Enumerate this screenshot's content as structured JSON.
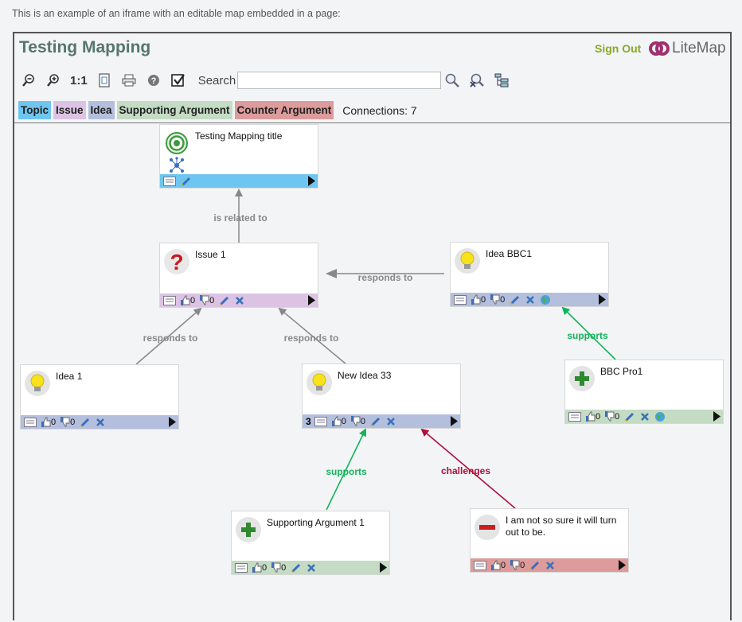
{
  "intro": "This is an example of an iframe with an editable map embedded in a page:",
  "header": {
    "title": "Testing Mapping",
    "sign_out": "Sign Out",
    "logo_text": "LiteMap"
  },
  "toolbar": {
    "actual_size": "1:1",
    "search_label": "Search",
    "search_value": ""
  },
  "legend": {
    "topic": "Topic",
    "issue": "Issue",
    "idea": "Idea",
    "supporting": "Supporting Argument",
    "counter": "Counter Argument",
    "connections": "Connections: 7"
  },
  "colors": {
    "topic": "#6ec6f0",
    "issue": "#dcc3e3",
    "idea": "#b4bfdd",
    "supporting": "#c4dbc4",
    "counter": "#dd9b9b",
    "neutral_link": "#888888",
    "support_link": "#11b45a",
    "challenge_link": "#b0103a"
  },
  "nodes": {
    "topic": {
      "title": "Testing Mapping title"
    },
    "issue1": {
      "title": "Issue 1",
      "votes_up": "0",
      "votes_down": "0"
    },
    "ideabbc1": {
      "title": "Idea BBC1",
      "votes_up": "0",
      "votes_down": "0"
    },
    "idea1": {
      "title": "Idea 1",
      "votes_up": "0",
      "votes_down": "0"
    },
    "newidea33": {
      "title": "New Idea 33",
      "count": "3",
      "votes_up": "0",
      "votes_down": "0"
    },
    "bbcpro1": {
      "title": "BBC Pro1",
      "votes_up": "0",
      "votes_down": "0"
    },
    "supporting1": {
      "title": "Supporting Argument 1",
      "votes_up": "0",
      "votes_down": "0"
    },
    "counter1": {
      "title": "I am not so sure it will turn out to be.",
      "votes_up": "0",
      "votes_down": "0"
    }
  },
  "links": {
    "related": "is related to",
    "responds_bbc": "responds to",
    "responds_idea1": "responds to",
    "responds_new33": "responds to",
    "supports_bbc": "supports",
    "supports_new33": "supports",
    "challenges": "challenges"
  }
}
